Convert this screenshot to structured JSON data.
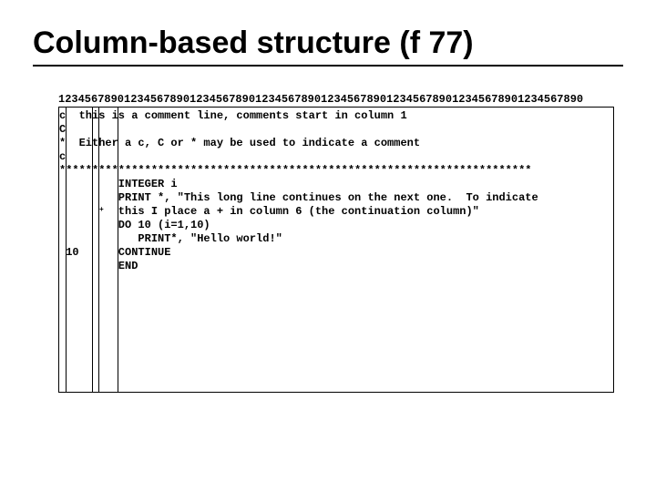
{
  "title": "Column-based structure (f 77)",
  "ruler": "12345678901234567890123456789012345678901234567890123456789012345678901234567890",
  "code_lines": {
    "l0": "c  this is a comment line, comments start in column 1",
    "l1": "C",
    "l2": "*  Either a c, C or * may be used to indicate a comment",
    "l3": "c",
    "l4": "************************************************************************",
    "l5": "         INTEGER i",
    "l6": "         PRINT *, \"This long line continues on the next one.  To indicate",
    "l7": "         this I place a + in column 6 (the continuation column)\"",
    "l8": "         DO 10 (i=1,10)",
    "l9": "            PRINT*, \"Hello world!\"",
    "l10": " 10      CONTINUE",
    "l11": "         END"
  },
  "continuation_mark": "+"
}
